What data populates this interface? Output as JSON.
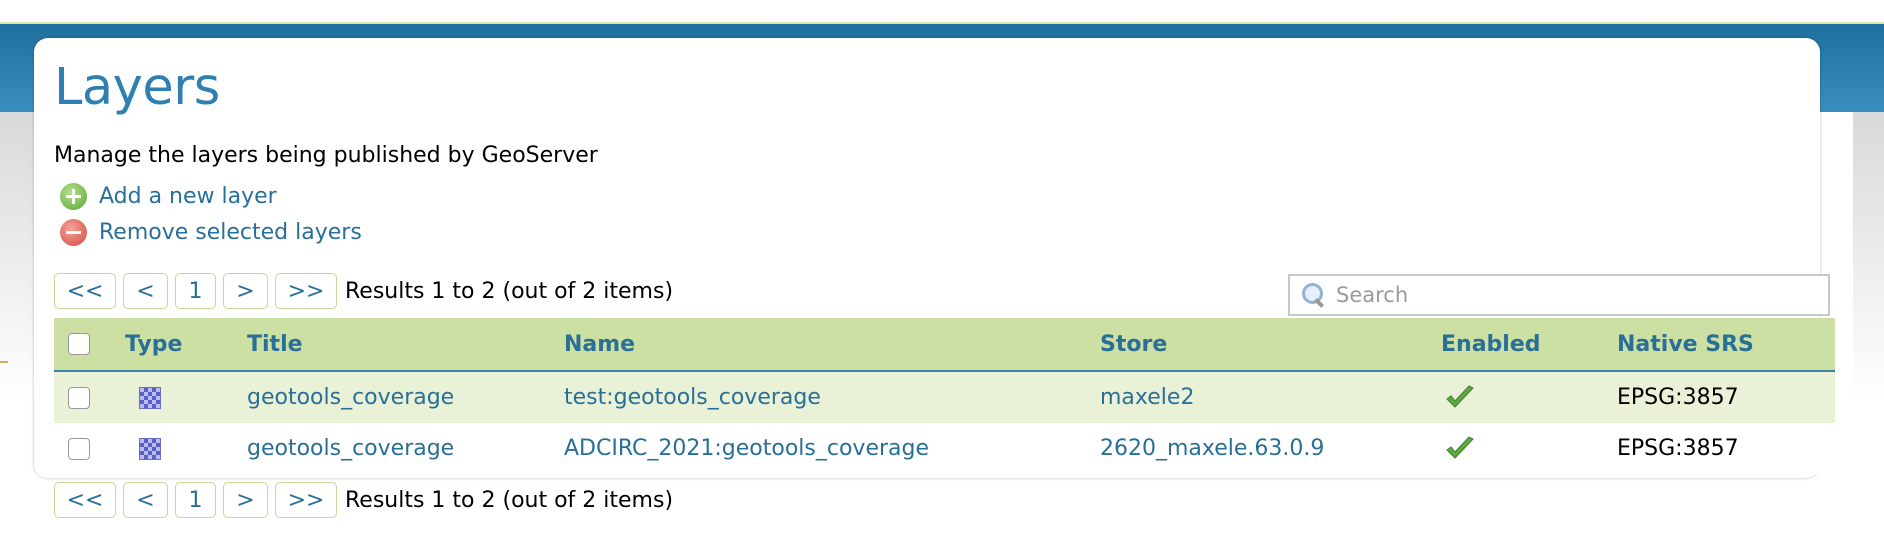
{
  "page": {
    "title": "Layers",
    "description": "Manage the layers being published by GeoServer"
  },
  "actions": {
    "add": "Add a new layer",
    "remove": "Remove selected layers"
  },
  "pager": {
    "first": "<<",
    "prev": "<",
    "page": "1",
    "next": ">",
    "last": ">>",
    "results": "Results 1 to 2 (out of 2 items)"
  },
  "search": {
    "placeholder": "Search",
    "value": ""
  },
  "table": {
    "columns": [
      "Type",
      "Title",
      "Name",
      "Store",
      "Enabled",
      "Native SRS"
    ],
    "rows": [
      {
        "type_icon": "raster-coverage-icon",
        "title": "geotools_coverage",
        "name": "test:geotools_coverage",
        "store": "maxele2",
        "enabled": "check-icon",
        "srs": "EPSG:3857"
      },
      {
        "type_icon": "raster-coverage-icon",
        "title": "geotools_coverage",
        "name": "ADCIRC_2021:geotools_coverage",
        "store": "2620_maxele.63.0.9",
        "enabled": "check-icon",
        "srs": "EPSG:3857"
      }
    ]
  },
  "colors": {
    "header_band": "#2a80b0",
    "table_header_bg": "#cde0a3",
    "link": "#2a6f97",
    "title": "#2f7fb0",
    "row_highlight": "#e9f1d6"
  }
}
